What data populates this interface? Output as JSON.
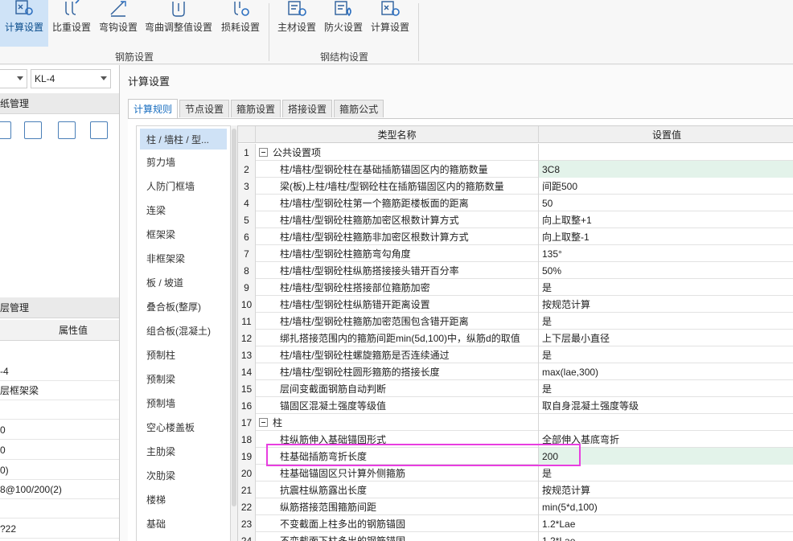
{
  "ribbon": {
    "rebar_buttons": [
      {
        "label": "计算设置",
        "icon": "calc-settings-icon",
        "active": true
      },
      {
        "label": "比重设置",
        "icon": "weight-settings-icon"
      },
      {
        "label": "弯钩设置",
        "icon": "hook-settings-icon"
      },
      {
        "label": "弯曲调整值设置",
        "icon": "bend-adjust-icon"
      },
      {
        "label": "损耗设置",
        "icon": "loss-settings-icon"
      }
    ],
    "rebar_group_label": "钢筋设置",
    "steel_buttons": [
      {
        "label": "主材设置",
        "icon": "main-material-icon"
      },
      {
        "label": "防火设置",
        "icon": "fireproof-icon"
      },
      {
        "label": "计算设置",
        "icon": "steel-calc-icon"
      }
    ],
    "steel_group_label": "钢结构设置"
  },
  "left_panel": {
    "combo_value": "KL-4",
    "combo_extra": "",
    "section1_title": "纸管理",
    "section2_title": "层管理",
    "prop_header": "属性值",
    "prop_values": [
      "-4",
      "层框架梁",
      "",
      "0",
      "0",
      "0)",
      "8@100/200(2)",
      "",
      "?22"
    ]
  },
  "dialog": {
    "title": "计算设置",
    "tabs": [
      "计算规则",
      "节点设置",
      "箍筋设置",
      "搭接设置",
      "箍筋公式"
    ],
    "active_tab": 0,
    "categories": [
      "柱 / 墙柱 / 型...",
      "剪力墙",
      "人防门框墙",
      "连梁",
      "框架梁",
      "非框架梁",
      "板 / 坡道",
      "叠合板(整厚)",
      "组合板(混凝土)",
      "预制柱",
      "预制梁",
      "预制墙",
      "空心楼盖板",
      "主肋梁",
      "次肋梁",
      "楼梯",
      "基础"
    ],
    "selected_category": 0,
    "grid_headers": {
      "name": "类型名称",
      "value": "设置值"
    },
    "rows": [
      {
        "num": "1",
        "name": "公共设置项",
        "value": "",
        "group": true
      },
      {
        "num": "2",
        "name": "柱/墙柱/型钢砼柱在基础插筋锚固区内的箍筋数量",
        "value": "3C8",
        "hl": true
      },
      {
        "num": "3",
        "name": "梁(板)上柱/墙柱/型钢砼柱在插筋锚固区内的箍筋数量",
        "value": "间距500"
      },
      {
        "num": "4",
        "name": "柱/墙柱/型钢砼柱第一个箍筋距楼板面的距离",
        "value": "50"
      },
      {
        "num": "5",
        "name": "柱/墙柱/型钢砼柱箍筋加密区根数计算方式",
        "value": "向上取整+1"
      },
      {
        "num": "6",
        "name": "柱/墙柱/型钢砼柱箍筋非加密区根数计算方式",
        "value": "向上取整-1"
      },
      {
        "num": "7",
        "name": "柱/墙柱/型钢砼柱箍筋弯勾角度",
        "value": "135°"
      },
      {
        "num": "8",
        "name": "柱/墙柱/型钢砼柱纵筋搭接接头错开百分率",
        "value": "50%"
      },
      {
        "num": "9",
        "name": "柱/墙柱/型钢砼柱搭接部位箍筋加密",
        "value": "是"
      },
      {
        "num": "10",
        "name": "柱/墙柱/型钢砼柱纵筋错开距离设置",
        "value": "按规范计算"
      },
      {
        "num": "11",
        "name": "柱/墙柱/型钢砼柱箍筋加密范围包含错开距离",
        "value": "是"
      },
      {
        "num": "12",
        "name": "绑扎搭接范围内的箍筋间距min(5d,100)中，纵筋d的取值",
        "value": "上下层最小直径"
      },
      {
        "num": "13",
        "name": "柱/墙柱/型钢砼柱螺旋箍筋是否连续通过",
        "value": "是"
      },
      {
        "num": "14",
        "name": "柱/墙柱/型钢砼柱圆形箍筋的搭接长度",
        "value": "max(lae,300)"
      },
      {
        "num": "15",
        "name": "层间变截面钢筋自动判断",
        "value": "是"
      },
      {
        "num": "16",
        "name": "锚固区混凝土强度等级值",
        "value": "取自身混凝土强度等级"
      },
      {
        "num": "17",
        "name": "柱",
        "value": "",
        "group": true
      },
      {
        "num": "18",
        "name": "柱纵筋伸入基础锚固形式",
        "value": "全部伸入基底弯折"
      },
      {
        "num": "19",
        "name": "柱基础插筋弯折长度",
        "value": "200",
        "hl": true
      },
      {
        "num": "20",
        "name": "柱基础锚固区只计算外侧箍筋",
        "value": "是"
      },
      {
        "num": "21",
        "name": "抗震柱纵筋露出长度",
        "value": "按规范计算"
      },
      {
        "num": "22",
        "name": "纵筋搭接范围箍筋间距",
        "value": "min(5*d,100)"
      },
      {
        "num": "23",
        "name": "不变截面上柱多出的钢筋锚固",
        "value": "1.2*Lae"
      },
      {
        "num": "24",
        "name": "不变截面下柱多出的钢筋锚固",
        "value": "1.2*Lae"
      }
    ]
  },
  "colors": {
    "highlight": "#e3f3ea",
    "selection": "#cfe2f6",
    "annotation": "#e83ee0",
    "accent": "#1a6fc0"
  }
}
